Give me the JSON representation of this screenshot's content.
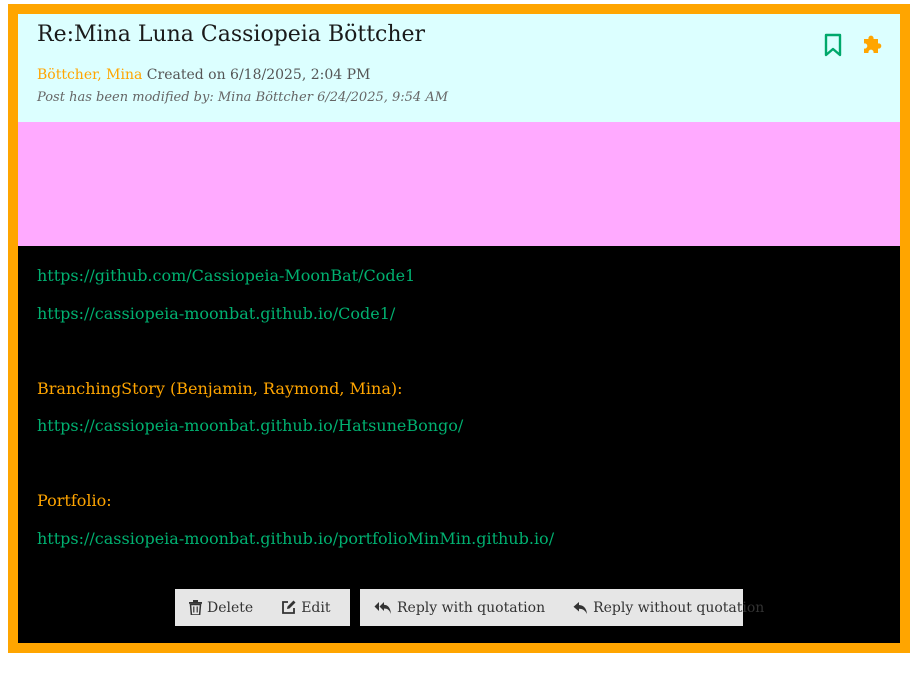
{
  "post": {
    "title": "Re:Mina Luna Cassiopeia Böttcher",
    "author": "Böttcher, Mina",
    "created": "Created on 6/18/2025, 2:04 PM",
    "modified": "Post has been modified by: Mina Böttcher 6/24/2025, 9:54 AM",
    "icons": {
      "bookmark": "bookmark-icon",
      "plugin": "puzzle-icon"
    }
  },
  "colors": {
    "border": "#ffa500",
    "header_bg": "#dcffff",
    "banner": "#ffaaff",
    "body_bg": "#000000",
    "link": "#00b070",
    "label": "#ffa500"
  },
  "content": {
    "link1": "https://github.com/Cassiopeia-MoonBat/Code1",
    "link2": "https://cassiopeia-moonbat.github.io/Code1/",
    "label_branching": "BranchingStory (Benjamin, Raymond, Mina):",
    "link3": "https://cassiopeia-moonbat.github.io/HatsuneBongo/",
    "label_portfolio": "Portfolio:",
    "link4": "https://cassiopeia-moonbat.github.io/portfolioMinMin.github.io/"
  },
  "actions": {
    "delete": "Delete",
    "edit": "Edit",
    "reply_quote": "Reply with quotation",
    "reply_noquote": "Reply without quotation"
  }
}
